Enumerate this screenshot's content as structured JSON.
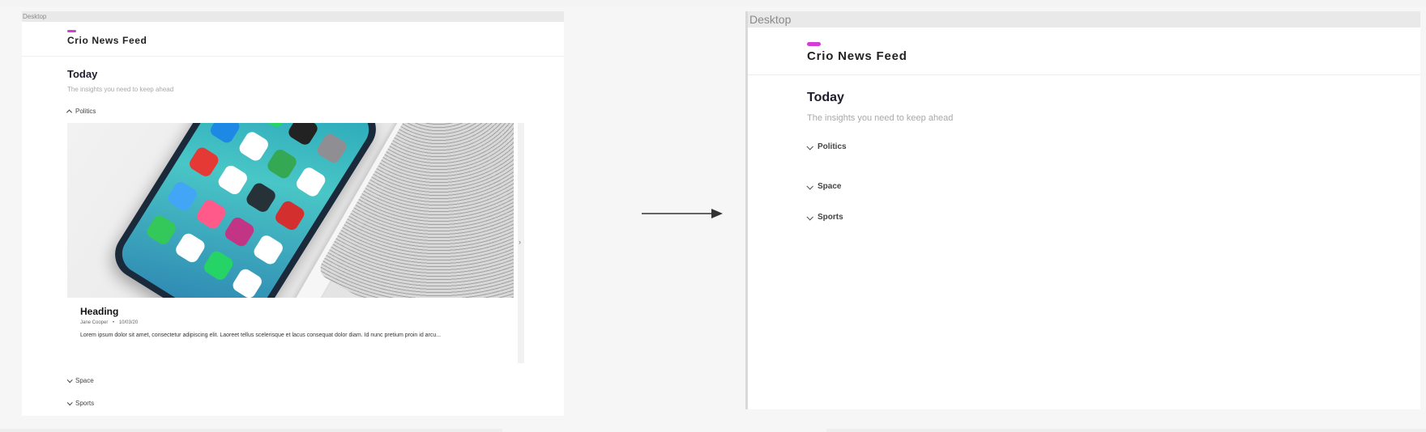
{
  "left_frame": {
    "frame_label": "Desktop",
    "header": {
      "title": "Crio News Feed"
    },
    "page": {
      "title": "Today",
      "subtitle": "The insights you need to keep ahead"
    },
    "sections": [
      {
        "label": "Politics",
        "state": "expanded"
      },
      {
        "label": "Space",
        "state": "collapsed"
      },
      {
        "label": "Sports",
        "state": "collapsed"
      }
    ],
    "card": {
      "heading": "Heading",
      "author": "Jane Cooper",
      "separator": "•",
      "date": "10/03/20",
      "excerpt": "Lorem ipsum dolor sit amet, consectetur adipiscing elit. Laoreet tellus scelerisque et lacus consequat dolor diam. Id nunc pretium proin id arcu...",
      "image_alt": "smartphone home screen on laptop"
    },
    "next_icon": "chevron-right-icon"
  },
  "right_frame": {
    "frame_label": "Desktop",
    "header": {
      "title": "Crio News Feed"
    },
    "page": {
      "title": "Today",
      "subtitle": "The insights you need to keep ahead"
    },
    "sections": [
      {
        "label": "Politics",
        "state": "collapsed"
      },
      {
        "label": "Space",
        "state": "collapsed"
      },
      {
        "label": "Sports",
        "state": "collapsed"
      }
    ]
  },
  "colors": {
    "accent": "#d43ed8",
    "frame_label_bg": "#e9e9e9",
    "subtitle_text": "#a8a8a8"
  }
}
